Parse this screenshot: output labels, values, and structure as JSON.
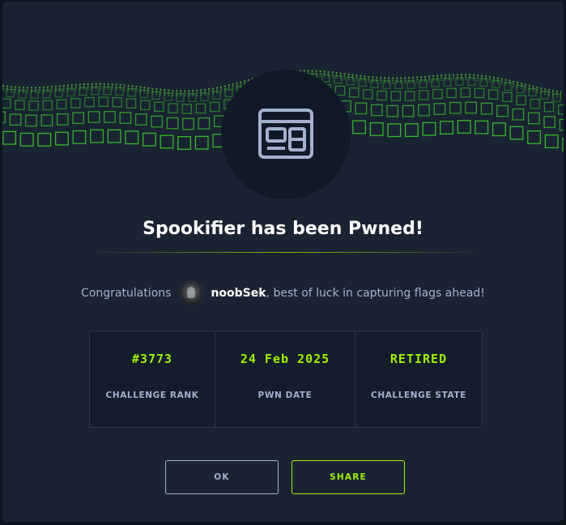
{
  "dialog": {
    "title": "Spookifier has been Pwned!",
    "congrats_prefix": "Congratulations",
    "username": "noobSek",
    "congrats_suffix": ", best of luck in capturing flags ahead!",
    "challenge_icon": "web-window-icon",
    "avatar_icon": "user-avatar"
  },
  "stats": [
    {
      "value": "#3773",
      "label": "CHALLENGE RANK"
    },
    {
      "value": "24 Feb 2025",
      "label": "PWN DATE"
    },
    {
      "value": "RETIRED",
      "label": "CHALLENGE STATE"
    }
  ],
  "buttons": {
    "ok_label": "OK",
    "share_label": "SHARE"
  },
  "colors": {
    "accent": "#9fef00",
    "background": "#1a2332",
    "muted_text": "#a4b1cd"
  }
}
